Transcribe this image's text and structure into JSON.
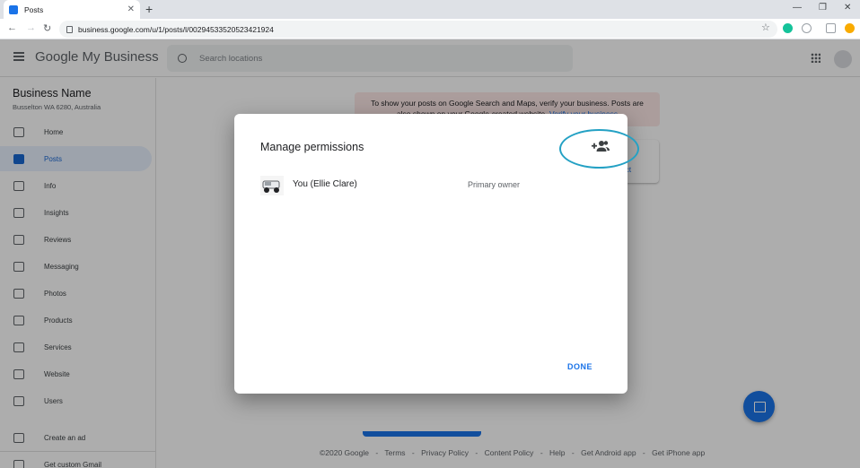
{
  "browser": {
    "tab_title": "Posts",
    "url": "business.google.com/u/1/posts/l/00294533520523421924"
  },
  "app": {
    "brand_google": "Google",
    "brand_product": "My Business",
    "search_placeholder": "Search locations"
  },
  "sidebar": {
    "business_name": "Business Name",
    "business_address": "Busselton WA 6280, Australia",
    "items": [
      {
        "label": "Home"
      },
      {
        "label": "Posts"
      },
      {
        "label": "Info"
      },
      {
        "label": "Insights"
      },
      {
        "label": "Reviews"
      },
      {
        "label": "Messaging"
      },
      {
        "label": "Photos"
      },
      {
        "label": "Products"
      },
      {
        "label": "Services"
      },
      {
        "label": "Website"
      },
      {
        "label": "Users"
      },
      {
        "label": "Create an ad"
      },
      {
        "label": "Get custom Gmail"
      }
    ]
  },
  "main": {
    "banner_text": "To show your posts on Google Search and Maps, verify your business. Posts are also shown on your Google-created website.",
    "banner_link": "Verify your business",
    "card_link": "duct"
  },
  "footer": {
    "links": [
      "©2020 Google",
      "-",
      "Terms",
      "-",
      "Privacy Policy",
      "-",
      "Content Policy",
      "-",
      "Help",
      "-",
      "Get Android app",
      "-",
      "Get iPhone app"
    ]
  },
  "dialog": {
    "title": "Manage permissions",
    "add_user_icon": "person-add-icon",
    "owner_name": "You (Ellie Clare)",
    "owner_role": "Primary owner",
    "done_label": "DONE"
  },
  "colors": {
    "accent": "#1a73e8",
    "highlight_ring": "#24a1c4",
    "banner_bg": "#fce8e6"
  }
}
